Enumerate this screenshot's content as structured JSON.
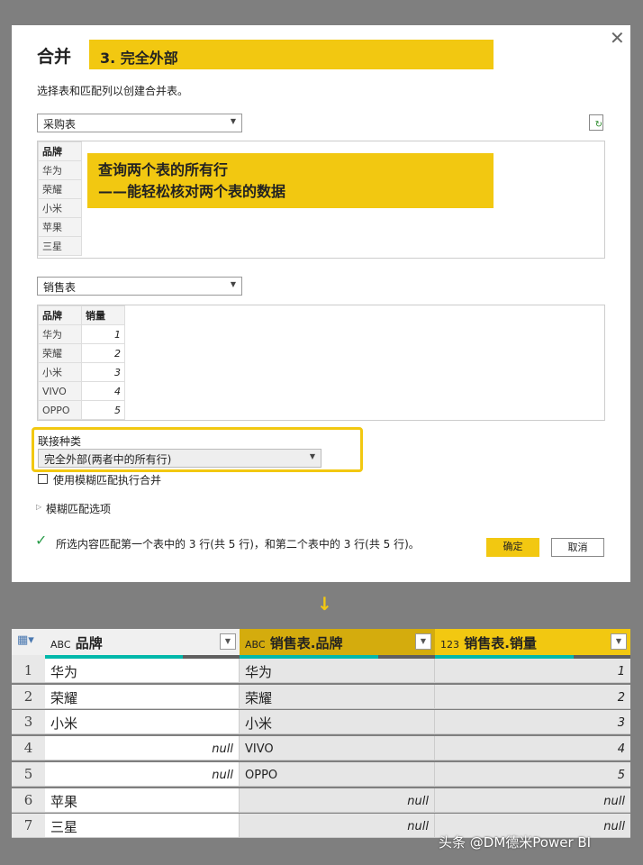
{
  "dialog": {
    "title": "合并",
    "banner_step": "3. 完全外部",
    "subtitle": "选择表和匹配列以创建合并表。",
    "table1": {
      "selected": "采购表",
      "header": "品牌",
      "rows": [
        "华为",
        "荣耀",
        "小米",
        "苹果",
        "三星"
      ]
    },
    "annotation": {
      "line1": "查询两个表的所有行",
      "line2": "——能轻松核对两个表的数据"
    },
    "table2": {
      "selected": "销售表",
      "headers": [
        "品牌",
        "销量"
      ],
      "rows": [
        [
          "华为",
          "1"
        ],
        [
          "荣耀",
          "2"
        ],
        [
          "小米",
          "3"
        ],
        [
          "VIVO",
          "4"
        ],
        [
          "OPPO",
          "5"
        ]
      ]
    },
    "join_kind_label": "联接种类",
    "join_kind_value": "完全外部(两者中的所有行)",
    "fuzzy_checkbox_label": "使用模糊匹配执行合并",
    "fuzzy_options_label": "模糊匹配选项",
    "status": "所选内容匹配第一个表中的 3 行(共 5 行)，和第二个表中的 3 行(共 5 行)。",
    "ok_label": "确定",
    "cancel_label": "取消"
  },
  "colors": {
    "accent": "#f2c811",
    "quality_valid": "#01b8aa",
    "header_col2": "#d4ac0d"
  },
  "result": {
    "columns": [
      {
        "type": "ABC",
        "name": "品牌"
      },
      {
        "type": "123x",
        "name": "销售表.品牌",
        "type_label": "ABC"
      },
      {
        "type_label": "123",
        "name": "销售表.销量"
      }
    ],
    "rows": [
      [
        "1",
        "华为",
        "华为",
        "1"
      ],
      [
        "2",
        "荣耀",
        "荣耀",
        "2"
      ],
      [
        "3",
        "小米",
        "小米",
        "3"
      ],
      [
        "4",
        "null",
        "VIVO",
        "4"
      ],
      [
        "5",
        "null",
        "OPPO",
        "5"
      ],
      [
        "6",
        "苹果",
        "null",
        "null"
      ],
      [
        "7",
        "三星",
        "null",
        "null"
      ]
    ]
  },
  "watermark": "头条 @DM德米Power BI"
}
